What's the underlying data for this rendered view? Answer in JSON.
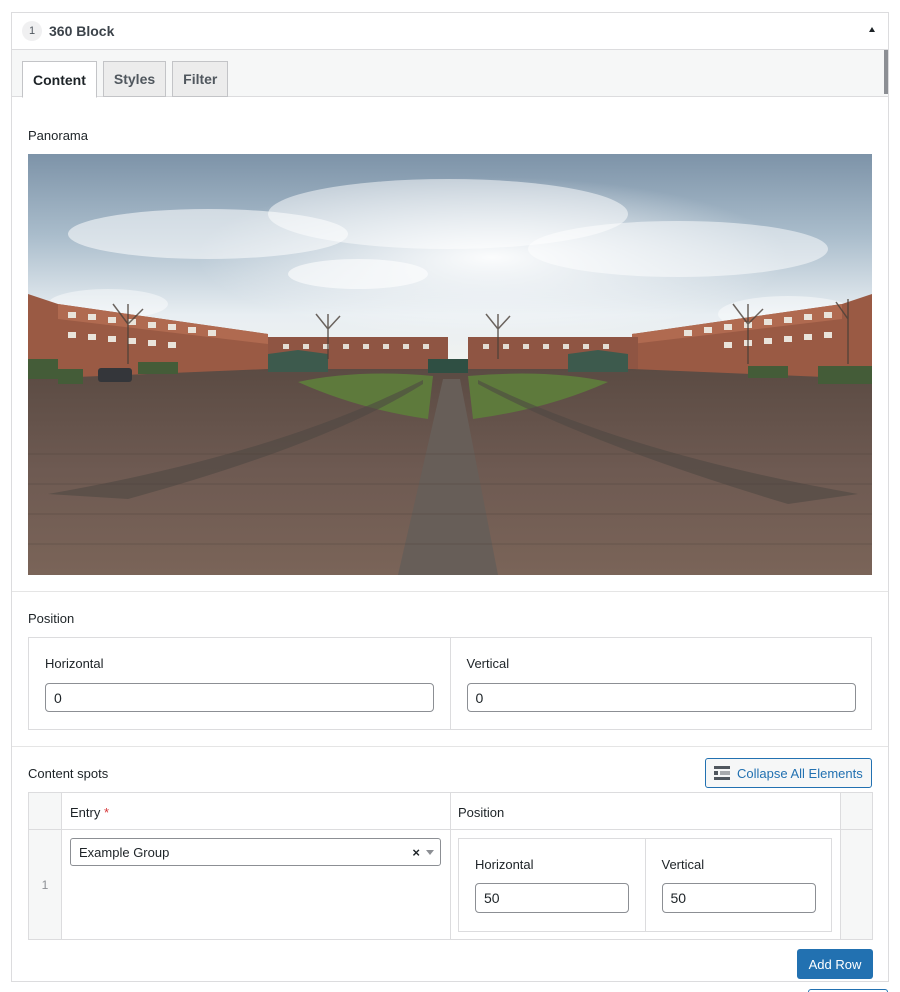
{
  "block": {
    "number": "1",
    "title": "360 Block"
  },
  "tabs": [
    {
      "label": "Content",
      "active": true
    },
    {
      "label": "Styles",
      "active": false
    },
    {
      "label": "Filter",
      "active": false
    }
  ],
  "panorama": {
    "label": "Panorama"
  },
  "position": {
    "label": "Position",
    "horizontal": {
      "label": "Horizontal",
      "value": "0"
    },
    "vertical": {
      "label": "Vertical",
      "value": "0"
    }
  },
  "content_spots": {
    "label": "Content spots",
    "collapse_label": "Collapse All Elements",
    "columns": {
      "entry": "Entry",
      "required_mark": "*",
      "position": "Position"
    },
    "rows": [
      {
        "index": "1",
        "entry": "Example Group",
        "clear": "×",
        "horizontal_label": "Horizontal",
        "horizontal_value": "50",
        "vertical_label": "Vertical",
        "vertical_value": "50"
      }
    ],
    "add_row_label": "Add Row"
  },
  "colors": {
    "accent": "#2271b1",
    "required": "#d63638",
    "border": "#dcdcde"
  }
}
